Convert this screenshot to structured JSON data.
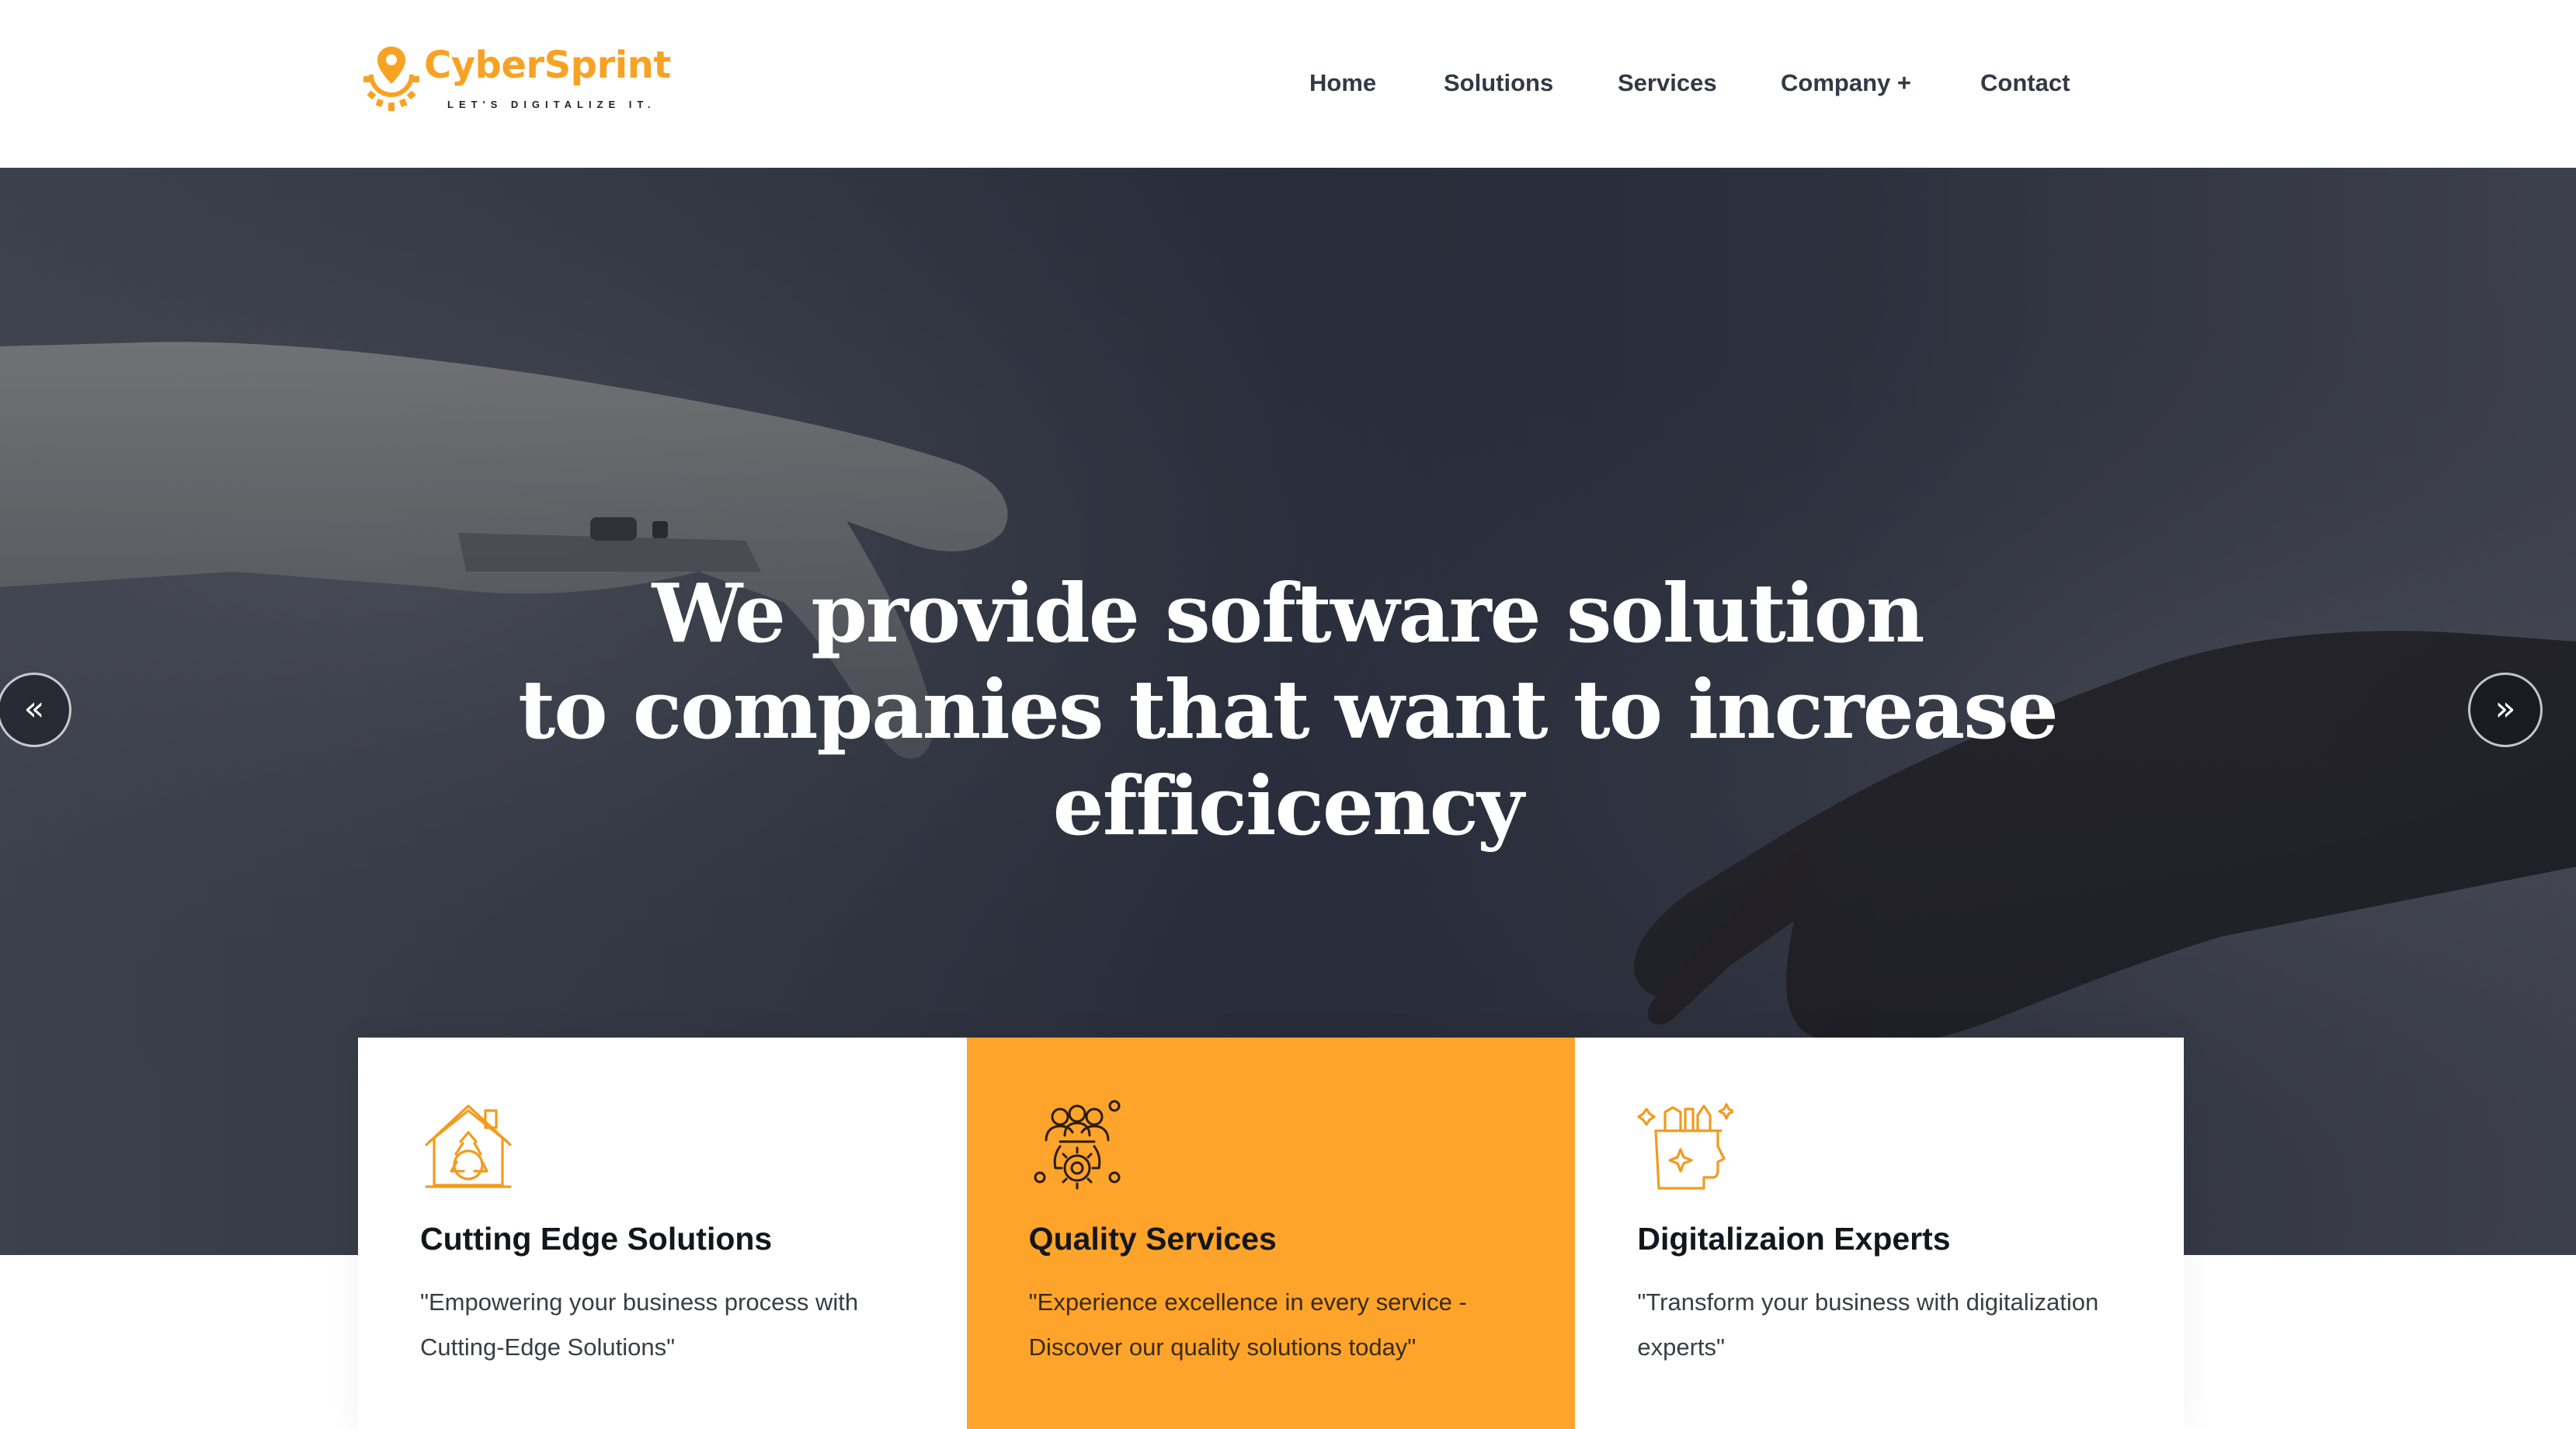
{
  "brand": {
    "name": "CyberSprint",
    "tagline": "LET'S DIGITALIZE IT.",
    "accent_color": "#f8a223",
    "logo_icon": "gear-pin-logo-icon"
  },
  "nav": {
    "items": [
      {
        "label": "Home"
      },
      {
        "label": "Solutions"
      },
      {
        "label": "Services"
      },
      {
        "label": "Company +"
      },
      {
        "label": "Contact"
      }
    ]
  },
  "hero": {
    "lines": [
      "We provide software solution",
      "to companies that want to increase",
      "efficicency"
    ],
    "prev_label": "«",
    "next_label": "»",
    "background_image": "robot-and-human-hands-reaching"
  },
  "features": [
    {
      "icon": "house-recycle-icon",
      "title": "Cutting Edge Solutions",
      "text": "\"Empowering your business process with Cutting-Edge Solutions\""
    },
    {
      "icon": "team-gear-icon",
      "title": "Quality Services",
      "text": "\"Experience excellence in every service - Discover our quality solutions today\"",
      "highlight_color": "#fea42b"
    },
    {
      "icon": "head-ideas-icon",
      "title": "Digitalizaion Experts",
      "text": "\"Transform your business with digitalization experts\""
    }
  ]
}
